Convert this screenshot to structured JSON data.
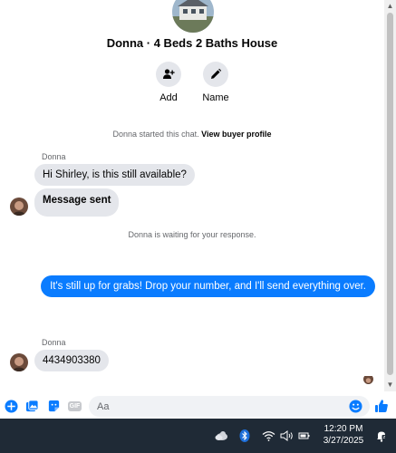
{
  "header": {
    "title": "Donna · 4 Beds 2 Baths House",
    "actions": [
      {
        "label": "Add",
        "icon": "add-person-icon"
      },
      {
        "label": "Name",
        "icon": "pencil-icon"
      }
    ]
  },
  "messages": {
    "started": {
      "text": "Donna started this chat.",
      "link": "View buyer profile"
    },
    "sender1": "Donna",
    "incoming1": "Hi Shirley, is this still available?",
    "incoming2": "Message sent",
    "waiting": "Donna is waiting for your response.",
    "outgoing1": "It's still up for grabs! Drop your number, and I'll send everything over.",
    "sender2": "Donna",
    "incoming3": "4434903380"
  },
  "composer": {
    "placeholder": "Aa",
    "icons": [
      "plus-icon",
      "photo-icon",
      "sticker-icon",
      "gif-icon",
      "emoji-icon",
      "thumbs-up-icon"
    ],
    "gif_label": "GIF"
  },
  "taskbar": {
    "time": "12:20 PM",
    "date": "3/27/2025",
    "icons": [
      "cloud-weather-icon",
      "bluetooth-icon",
      "wifi-icon",
      "speaker-icon",
      "notification-icon"
    ]
  },
  "colors": {
    "accent": "#0a7cff",
    "bubble_in": "#e4e6eb",
    "taskbar": "#1f2a36"
  }
}
